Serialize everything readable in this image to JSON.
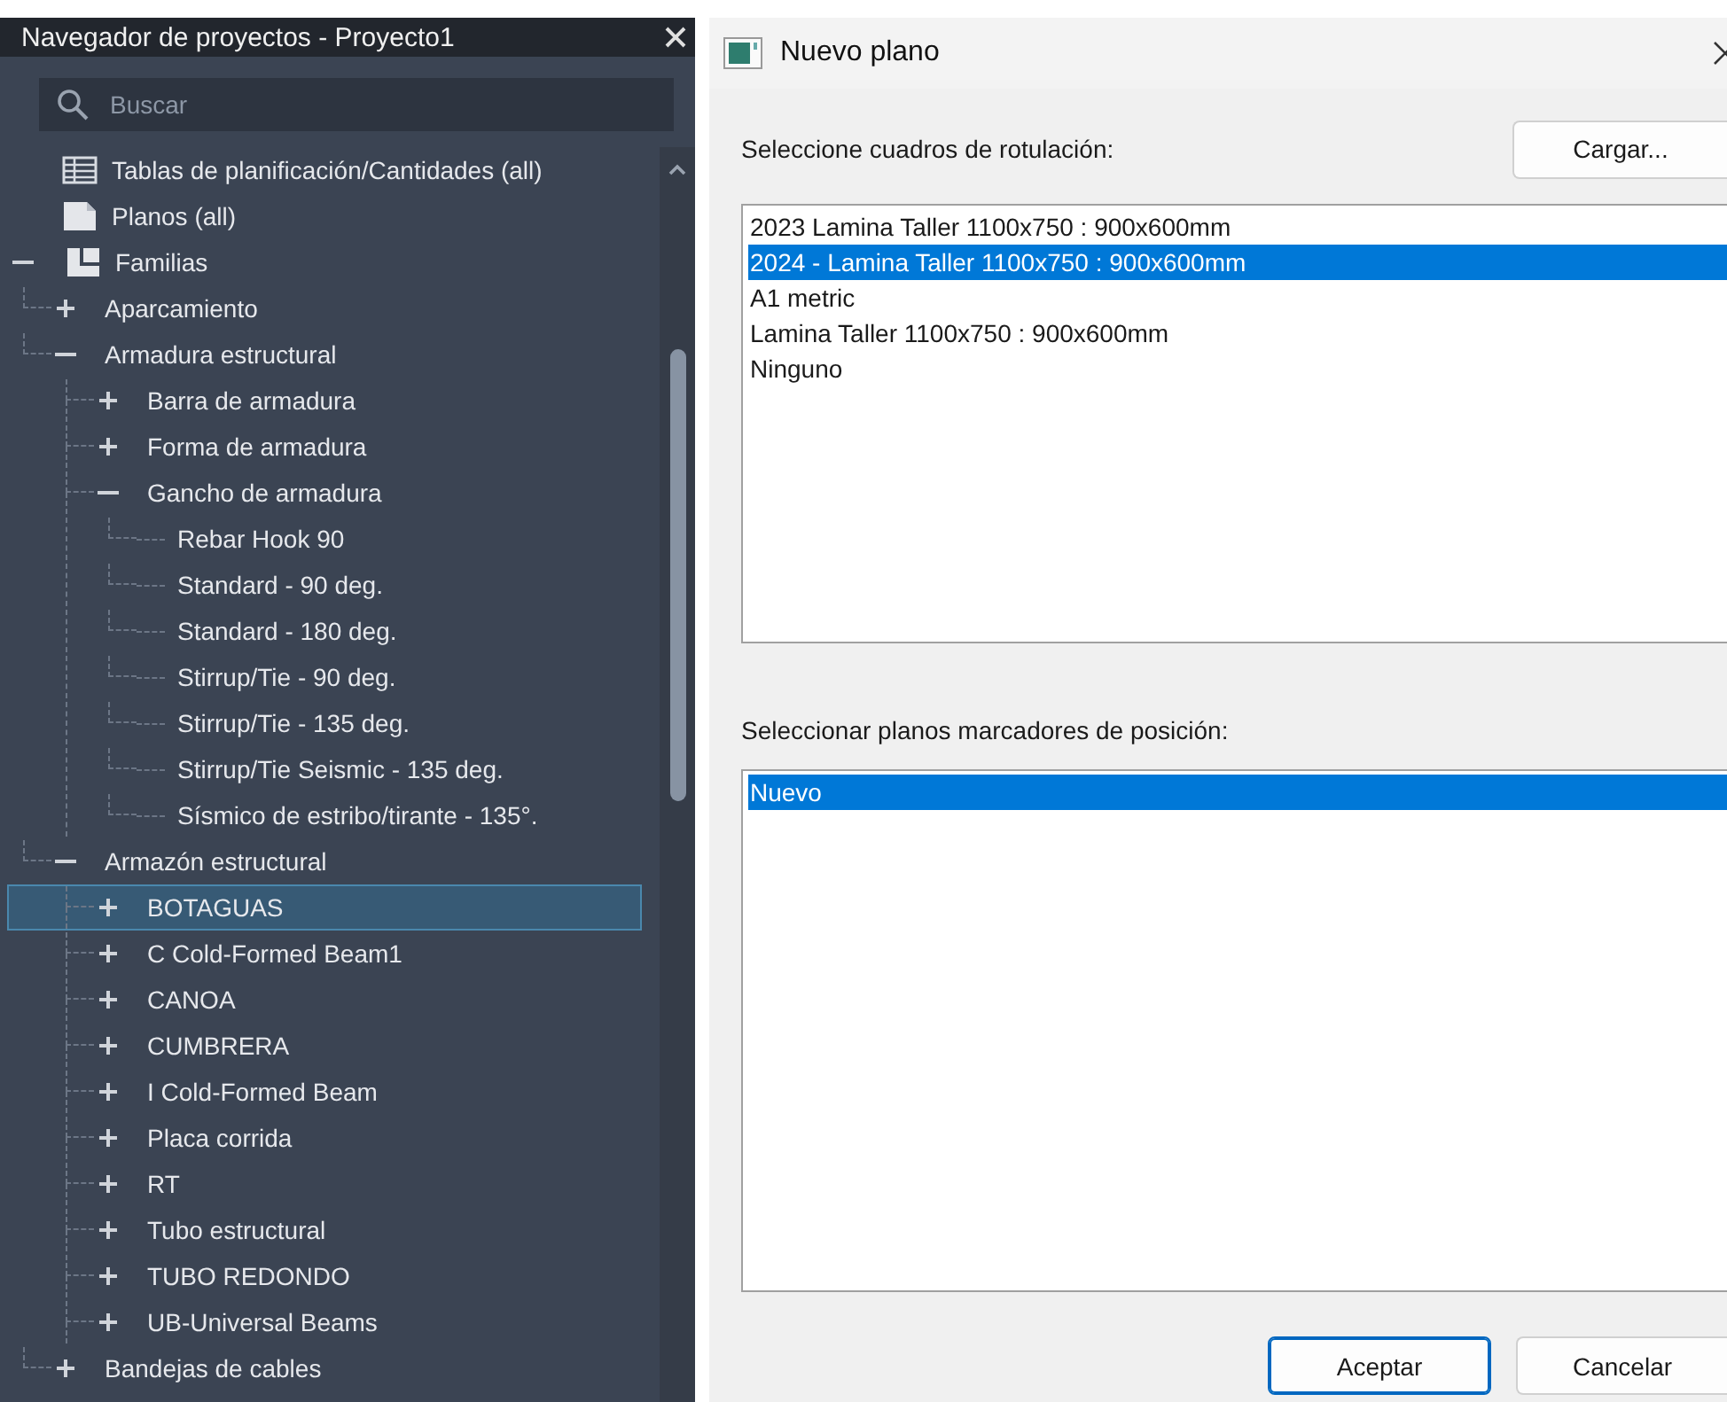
{
  "browser": {
    "title": "Navegador de proyectos - Proyecto1",
    "search": {
      "placeholder": "Buscar"
    },
    "tree": [
      {
        "label": "Tablas de planificación/Cantidades (all)",
        "kind": "schedules",
        "selected": false
      },
      {
        "label": "Planos (all)",
        "kind": "sheets",
        "selected": false
      },
      {
        "label": "Familias",
        "kind": "families",
        "selected": false,
        "expanded": true,
        "children": [
          {
            "label": "Aparcamiento",
            "selected": false,
            "expanded": false
          },
          {
            "label": "Armadura estructural",
            "selected": false,
            "expanded": true,
            "children": [
              {
                "label": "Barra de armadura",
                "selected": false,
                "expanded": false
              },
              {
                "label": "Forma de armadura",
                "selected": false,
                "expanded": false
              },
              {
                "label": "Gancho de armadura",
                "selected": false,
                "expanded": true,
                "children": [
                  {
                    "label": "Rebar Hook 90",
                    "selected": false
                  },
                  {
                    "label": "Standard - 90 deg.",
                    "selected": false
                  },
                  {
                    "label": "Standard - 180 deg.",
                    "selected": false
                  },
                  {
                    "label": "Stirrup/Tie - 90 deg.",
                    "selected": false
                  },
                  {
                    "label": "Stirrup/Tie - 135 deg.",
                    "selected": false
                  },
                  {
                    "label": "Stirrup/Tie Seismic - 135 deg.",
                    "selected": false
                  },
                  {
                    "label": "Sísmico de estribo/tirante - 135°.",
                    "selected": false
                  }
                ]
              }
            ]
          },
          {
            "label": "Armazón estructural",
            "selected": false,
            "expanded": true,
            "children": [
              {
                "label": "BOTAGUAS",
                "selected": true,
                "expanded": false
              },
              {
                "label": "C Cold-Formed Beam1",
                "selected": false,
                "expanded": false
              },
              {
                "label": "CANOA",
                "selected": false,
                "expanded": false
              },
              {
                "label": "CUMBRERA",
                "selected": false,
                "expanded": false
              },
              {
                "label": "I Cold-Formed Beam",
                "selected": false,
                "expanded": false
              },
              {
                "label": "Placa corrida",
                "selected": false,
                "expanded": false
              },
              {
                "label": "RT",
                "selected": false,
                "expanded": false
              },
              {
                "label": "Tubo estructural",
                "selected": false,
                "expanded": false
              },
              {
                "label": "TUBO REDONDO",
                "selected": false,
                "expanded": false
              },
              {
                "label": "UB-Universal Beams",
                "selected": false,
                "expanded": false
              }
            ]
          },
          {
            "label": "Bandejas de cables",
            "selected": false,
            "expanded": false
          }
        ]
      }
    ]
  },
  "dialog": {
    "title": "Nuevo plano",
    "title_blocks_label": "Seleccione cuadros de rotulación:",
    "load_button": "Cargar...",
    "title_blocks": [
      {
        "label": "2023 Lamina Taller 1100x750 : 900x600mm",
        "selected": false
      },
      {
        "label": "2024 - Lamina Taller 1100x750 : 900x600mm",
        "selected": true
      },
      {
        "label": "A1 metric",
        "selected": false
      },
      {
        "label": "Lamina Taller 1100x750 : 900x600mm",
        "selected": false
      },
      {
        "label": "Ninguno",
        "selected": false
      }
    ],
    "placeholders_label": "Seleccionar planos marcadores de posición:",
    "placeholders": [
      {
        "label": "Nuevo",
        "selected": true
      }
    ],
    "buttons": [
      {
        "label": "Aceptar",
        "default": true
      },
      {
        "label": "Cancelar",
        "default": false
      }
    ]
  }
}
